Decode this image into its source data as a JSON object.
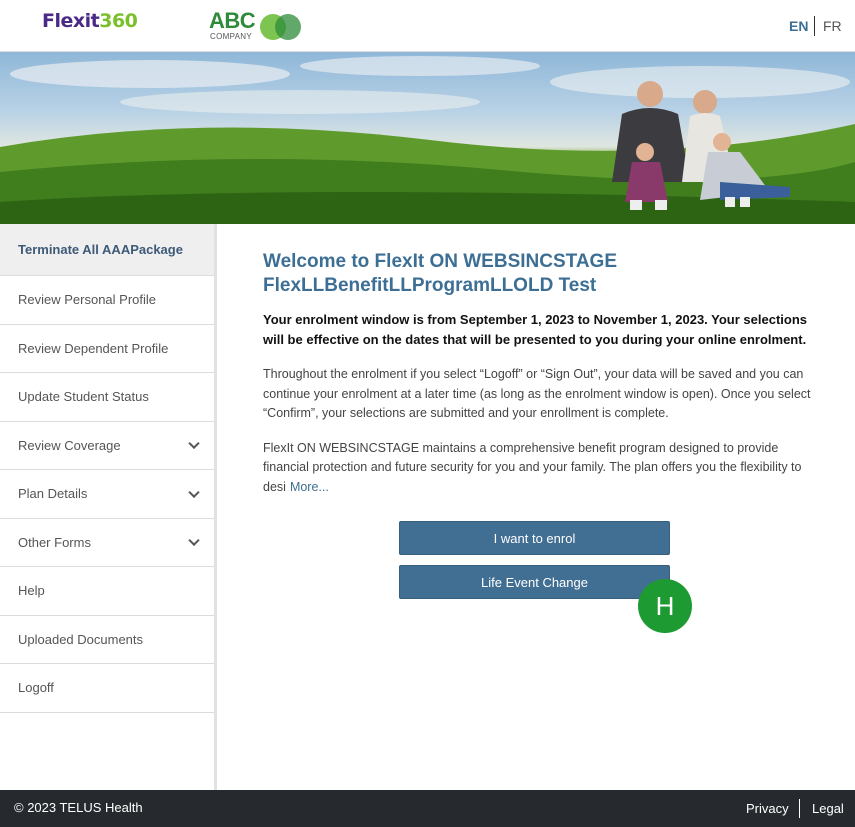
{
  "header": {
    "logo_part1": "Flexit",
    "logo_part2": "360",
    "company_logo_text": "ABC",
    "company_logo_sub": "COMPANY",
    "lang_en": "EN",
    "lang_fr": "FR"
  },
  "sidebar": {
    "items": [
      {
        "label": "Terminate All AAAPackage",
        "active": true
      },
      {
        "label": "Review Personal Profile"
      },
      {
        "label": "Review Dependent Profile"
      },
      {
        "label": "Update Student Status"
      },
      {
        "label": "Review Coverage",
        "expandable": true
      },
      {
        "label": "Plan Details",
        "expandable": true
      },
      {
        "label": "Other Forms",
        "expandable": true
      },
      {
        "label": "Help"
      },
      {
        "label": "Uploaded Documents"
      },
      {
        "label": "Logoff"
      }
    ]
  },
  "main": {
    "welcome_line1": "Welcome to FlexIt ON WEBSINCSTAGE",
    "welcome_line2": "FlexLLBenefitLLProgramLLOLD Test",
    "enrolment_window": "Your enrolment window is from September 1, 2023 to November 1, 2023. Your selections will be effective on the dates that will be presented to you during your online enrolment.",
    "paragraph1": "Throughout the enrolment if you select “Logoff” or “Sign Out”, your data will be saved and you can continue your enrolment at a later time (as long as the enrolment window is open). Once you select “Confirm”, your selections are submitted and your enrollment is complete.",
    "paragraph2": "FlexIt ON WEBSINCSTAGE maintains a comprehensive benefit program designed to provide financial protection and future security for you and your family.  The plan offers you the flexibility to desi",
    "more_link": "More...",
    "enrol_button": "I want to enrol",
    "life_event_button": "Life Event Change",
    "badge_letter": "H"
  },
  "footer": {
    "copyright": "© 2023 TELUS Health",
    "privacy": "Privacy",
    "legal": "Legal"
  },
  "colors": {
    "accent": "#3d6f95",
    "button": "#416e93",
    "badge": "#1e9a32",
    "footer_bg": "#262a2e"
  }
}
